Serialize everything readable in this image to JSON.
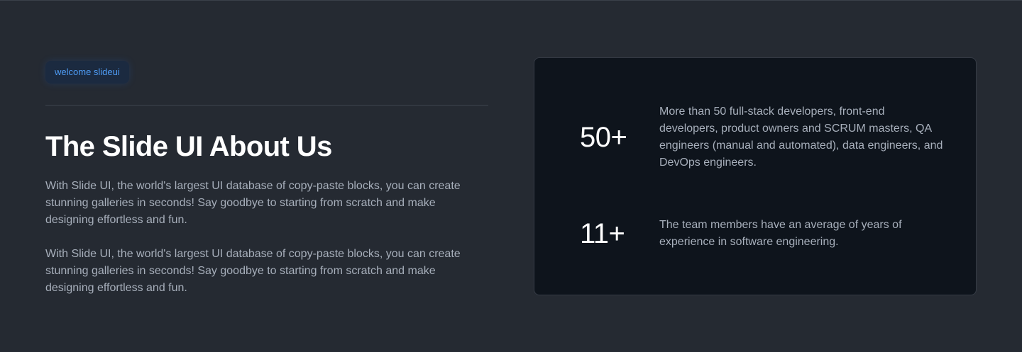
{
  "intro": {
    "badge": "welcome slideui",
    "title": "The Slide UI About Us",
    "paragraphs": [
      "With Slide UI, the world's largest UI database of copy-paste blocks, you can create stunning galleries in seconds! Say goodbye to starting from scratch and make designing effortless and fun.",
      "With Slide UI, the world's largest UI database of copy-paste blocks, you can create stunning galleries in seconds! Say goodbye to starting from scratch and make designing effortless and fun."
    ]
  },
  "stats": [
    {
      "number": "50+",
      "text": "More than 50 full-stack developers, front-end developers, product owners and SCRUM masters, QA engineers (manual and automated), data engineers, and DevOps engineers."
    },
    {
      "number": "11+",
      "text": "The team members have an average of years of experience in software engineering."
    }
  ],
  "colors": {
    "background": "#252a32",
    "card": "#0e141c",
    "accent": "#4e9cf5",
    "muted_text": "#a7afbb"
  }
}
